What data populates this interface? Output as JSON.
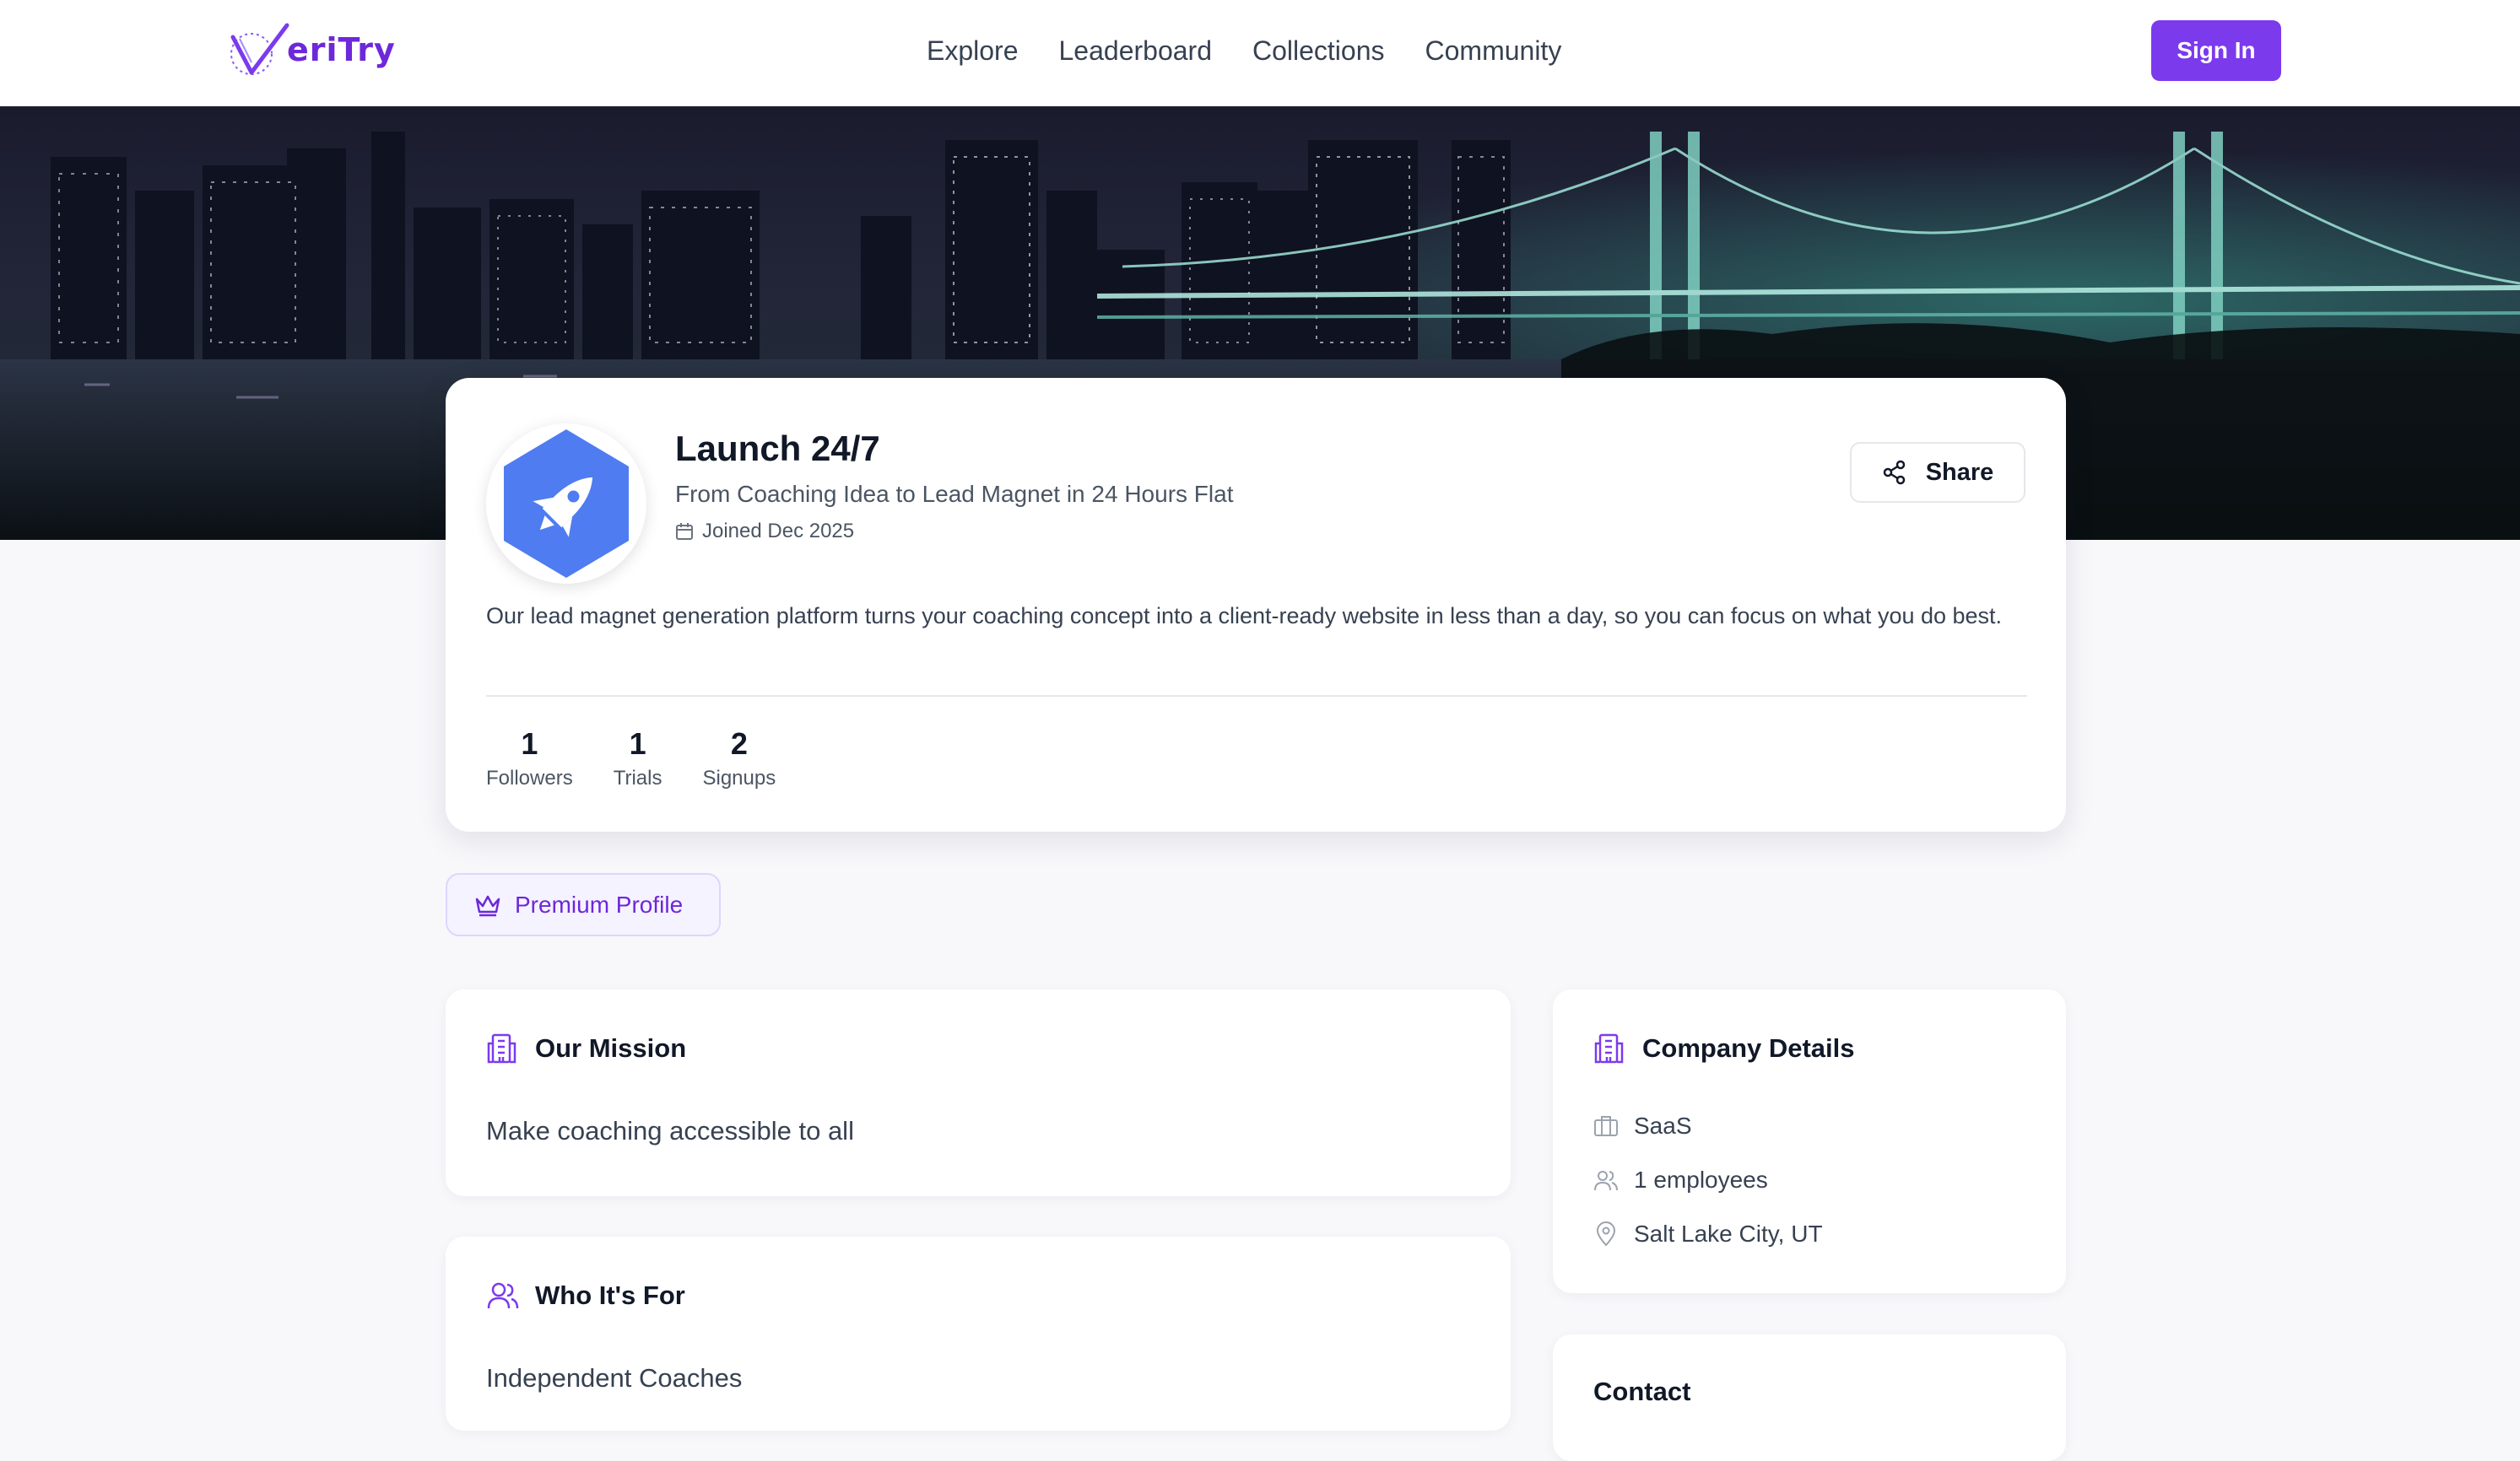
{
  "header": {
    "logo_text": "eriTry",
    "nav": [
      "Explore",
      "Leaderboard",
      "Collections",
      "Community"
    ],
    "sign_in": "Sign In"
  },
  "profile": {
    "name": "Launch 24/7",
    "tagline": "From Coaching Idea to Lead Magnet in 24 Hours Flat",
    "joined": "Joined Dec 2025",
    "share_label": "Share",
    "description": "Our lead magnet generation platform turns your coaching concept into a client-ready website in less than a day, so you can focus on what you do best.",
    "stats": [
      {
        "value": "1",
        "label": "Followers"
      },
      {
        "value": "1",
        "label": "Trials"
      },
      {
        "value": "2",
        "label": "Signups"
      }
    ]
  },
  "premium_badge": "Premium Profile",
  "mission": {
    "title": "Our Mission",
    "text": "Make coaching accessible to all"
  },
  "audience": {
    "title": "Who It's For",
    "text": "Independent Coaches"
  },
  "company": {
    "title": "Company Details",
    "industry": "SaaS",
    "employees": "1 employees",
    "location": "Salt Lake City, UT"
  },
  "contact": {
    "title": "Contact"
  },
  "colors": {
    "accent": "#7c3aed",
    "avatar_blue": "#4f7cf0"
  },
  "icons": [
    "logo-check-icon",
    "rocket-icon",
    "calendar-icon",
    "share-icon",
    "crown-icon",
    "building-icon",
    "users-icon",
    "briefcase-icon",
    "map-pin-icon"
  ]
}
